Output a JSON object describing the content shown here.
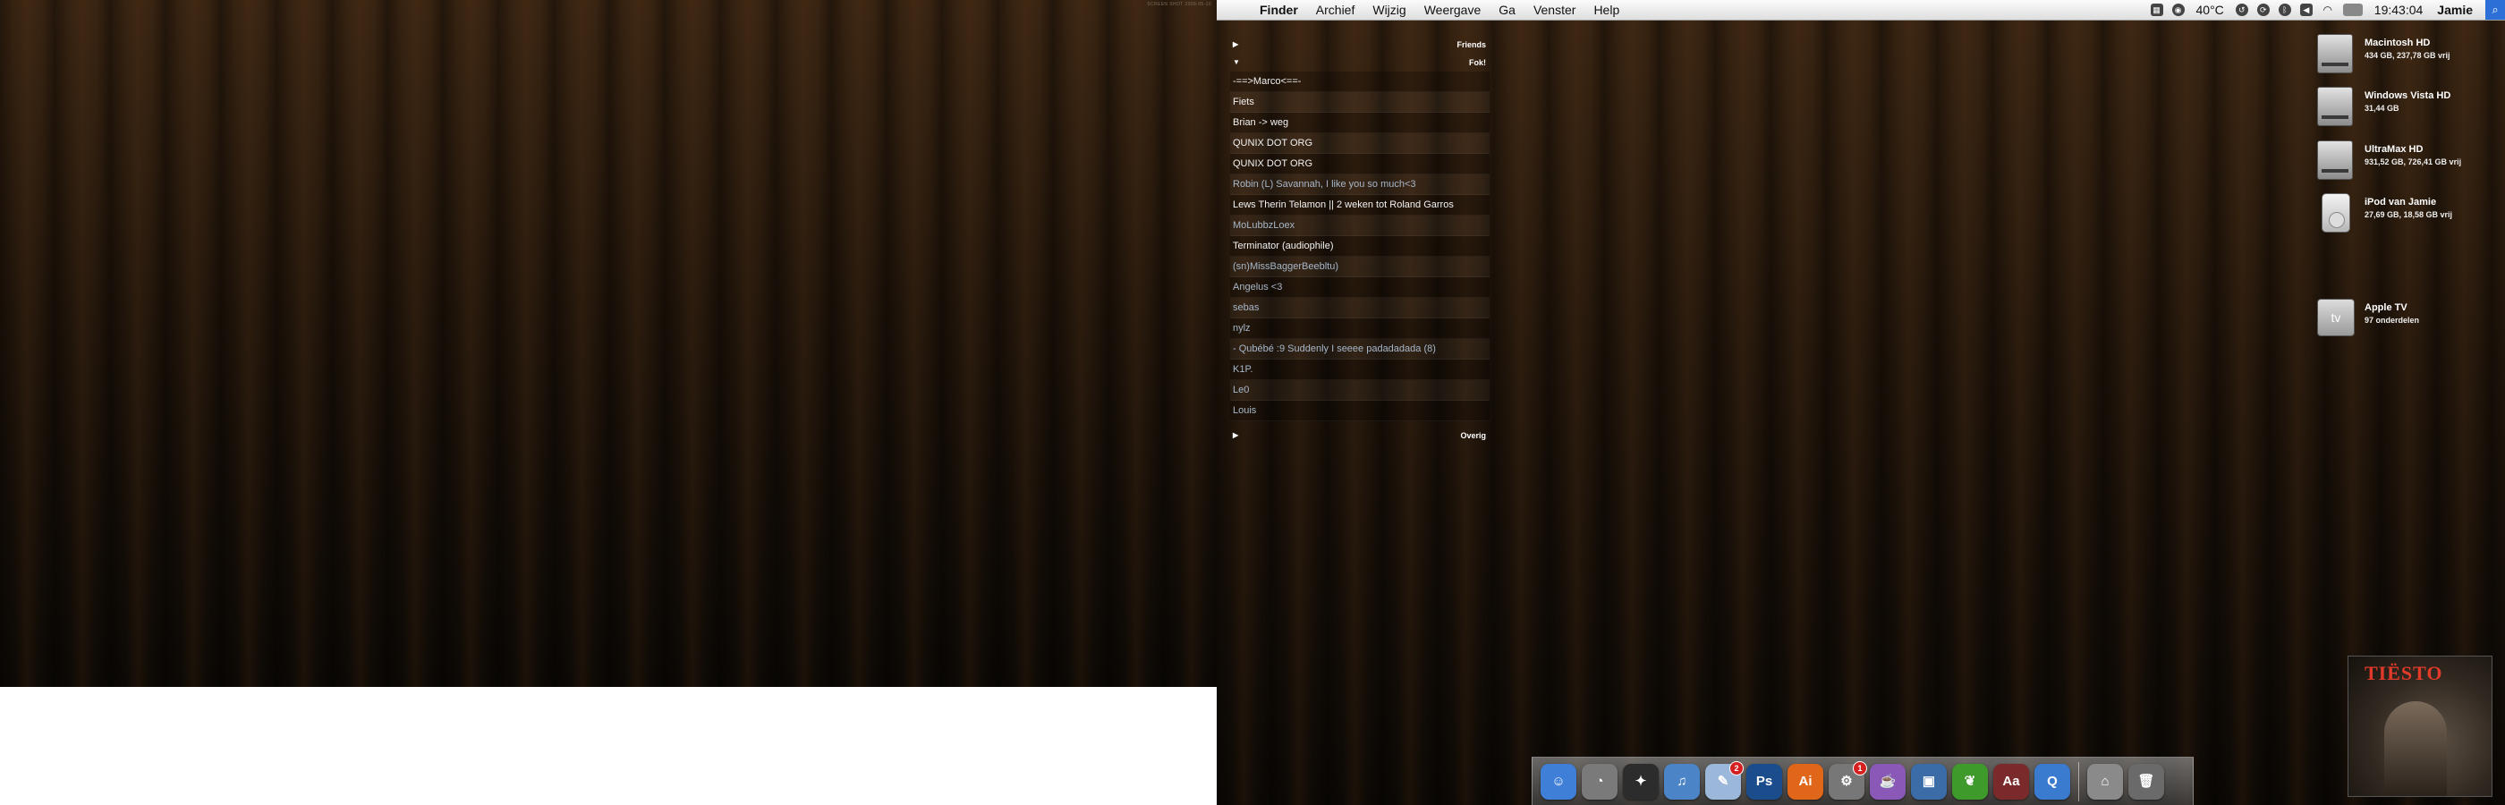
{
  "left_screen": {
    "label": "SCREEN SHOT 2008-05-10"
  },
  "menubar": {
    "apple_icon": "",
    "items": [
      "Finder",
      "Archief",
      "Wijzig",
      "Weergave",
      "Ga",
      "Venster",
      "Help"
    ],
    "status": {
      "temperature": "40°C",
      "clock": "19:43:04",
      "user": "Jamie",
      "icons": [
        "calendar-icon",
        "dvd-icon",
        "time-machine-icon",
        "sync-icon",
        "bluetooth-icon",
        "volume-icon",
        "wifi-icon",
        "battery-icon",
        "spotlight-icon"
      ]
    }
  },
  "buddy_list": {
    "groups": [
      {
        "name": "Friends",
        "expanded": false,
        "arrow": "▶"
      },
      {
        "name": "Fok!",
        "expanded": true,
        "arrow": "▼",
        "buddies": [
          {
            "name": "-==>Marco<==-",
            "status": "online"
          },
          {
            "name": "Fiets",
            "status": "online"
          },
          {
            "name": "Brian -> weg",
            "status": "online"
          },
          {
            "name": "QUNIX DOT ORG",
            "status": "online"
          },
          {
            "name": "QUNIX DOT ORG",
            "status": "online"
          },
          {
            "name": "Robin (L) Savannah, I like you so much<3",
            "status": "away"
          },
          {
            "name": "Lews Therin Telamon || 2 weken tot Roland Garros",
            "status": "online"
          },
          {
            "name": "MoLubbzLoex",
            "status": "away"
          },
          {
            "name": "Terminator (audiophile)",
            "status": "online"
          },
          {
            "name": "(sn)MissBaggerBeebltu)",
            "status": "away"
          },
          {
            "name": "Angelus <3",
            "status": "away"
          },
          {
            "name": "sebas",
            "status": "away"
          },
          {
            "name": "nylz",
            "status": "away"
          },
          {
            "name": "- Qubébé :9 Suddenly I seeee padadadada (8)",
            "status": "away"
          },
          {
            "name": "K1P.",
            "status": "away"
          },
          {
            "name": "Le0",
            "status": "away"
          },
          {
            "name": "Louis",
            "status": "away"
          }
        ]
      },
      {
        "name": "Overig",
        "expanded": false,
        "arrow": "▶"
      }
    ]
  },
  "desktop_icons": [
    {
      "name": "Macintosh HD",
      "info": "434 GB, 237,78 GB vrij",
      "kind": "drive"
    },
    {
      "name": "Windows Vista HD",
      "info": "31,44 GB",
      "kind": "drive"
    },
    {
      "name": "UltraMax HD",
      "info": "931,52 GB, 726,41 GB vrij",
      "kind": "drive"
    },
    {
      "name": "iPod van Jamie",
      "info": "27,69 GB, 18,58 GB vrij",
      "kind": "ipod"
    },
    {
      "name": "Apple TV",
      "info": "97 onderdelen",
      "kind": "appletv"
    }
  ],
  "album_art": {
    "artist": "TIËSTO"
  },
  "dock": {
    "apps": [
      {
        "name": "finder",
        "glyph": "☺",
        "color": "#3f7fd8"
      },
      {
        "name": "dashboard",
        "glyph": "◔",
        "color": "#7a7a7a"
      },
      {
        "name": "adium",
        "glyph": "✦",
        "color": "#2c2c2c"
      },
      {
        "name": "itunes",
        "glyph": "♫",
        "color": "#4b84c7"
      },
      {
        "name": "preview",
        "glyph": "✎",
        "color": "#9bb7d9",
        "badge": "2"
      },
      {
        "name": "photoshop",
        "glyph": "Ps",
        "color": "#1b4d8c"
      },
      {
        "name": "illustrator",
        "glyph": "Ai",
        "color": "#e0661a"
      },
      {
        "name": "system-preferences",
        "glyph": "⚙",
        "color": "#777777",
        "badge": "1"
      },
      {
        "name": "cup-app",
        "glyph": "☕",
        "color": "#8a59b8"
      },
      {
        "name": "transmit",
        "glyph": "▣",
        "color": "#3c6ca8"
      },
      {
        "name": "coda",
        "glyph": "❦",
        "color": "#3e9a2a"
      },
      {
        "name": "dictionary",
        "glyph": "Aa",
        "color": "#7a2a2a"
      },
      {
        "name": "quicktime",
        "glyph": "Q",
        "color": "#3a7bd0"
      }
    ],
    "right": [
      {
        "name": "home-folder",
        "glyph": "⌂",
        "color": "#8a8a8a"
      },
      {
        "name": "trash",
        "glyph": "🗑",
        "color": "#6a6a6a"
      }
    ]
  }
}
